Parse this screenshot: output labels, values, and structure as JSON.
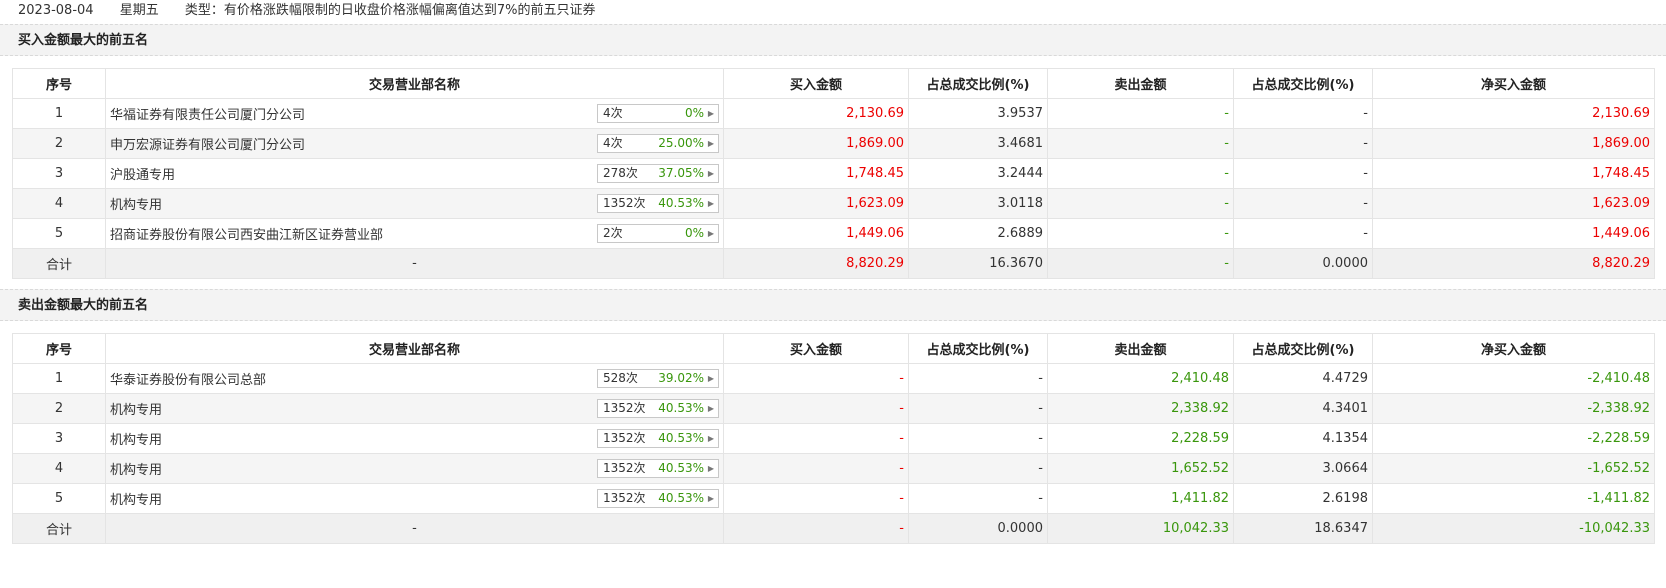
{
  "topline": {
    "date": "2023-08-04",
    "weekday": "星期五",
    "type_text": "类型：有价格涨跌幅限制的日收盘价格涨幅偏离值达到7%的前五只证券"
  },
  "headers": [
    "序号",
    "交易营业部名称",
    "买入金额",
    "占总成交比例(%)",
    "卖出金额",
    "占总成交比例(%)",
    "净买入金额"
  ],
  "buy": {
    "title": "买入金额最大的前五名",
    "rows": [
      {
        "no": "1",
        "name": "华福证券有限责任公司厦门分公司",
        "times": "4次",
        "pct": "0%",
        "buy": "2,130.69",
        "buy_ratio": "3.9537",
        "sell": "-",
        "sell_ratio": "-",
        "net": "2,130.69"
      },
      {
        "no": "2",
        "name": "申万宏源证券有限公司厦门分公司",
        "times": "4次",
        "pct": "25.00%",
        "buy": "1,869.00",
        "buy_ratio": "3.4681",
        "sell": "-",
        "sell_ratio": "-",
        "net": "1,869.00"
      },
      {
        "no": "3",
        "name": "沪股通专用",
        "times": "278次",
        "pct": "37.05%",
        "buy": "1,748.45",
        "buy_ratio": "3.2444",
        "sell": "-",
        "sell_ratio": "-",
        "net": "1,748.45"
      },
      {
        "no": "4",
        "name": "机构专用",
        "times": "1352次",
        "pct": "40.53%",
        "buy": "1,623.09",
        "buy_ratio": "3.0118",
        "sell": "-",
        "sell_ratio": "-",
        "net": "1,623.09"
      },
      {
        "no": "5",
        "name": "招商证券股份有限公司西安曲江新区证券营业部",
        "times": "2次",
        "pct": "0%",
        "buy": "1,449.06",
        "buy_ratio": "2.6889",
        "sell": "-",
        "sell_ratio": "-",
        "net": "1,449.06"
      }
    ],
    "total": {
      "label": "合计",
      "name": "-",
      "buy": "8,820.29",
      "buy_ratio": "16.3670",
      "sell": "-",
      "sell_ratio": "0.0000",
      "net": "8,820.29"
    }
  },
  "sell": {
    "title": "卖出金额最大的前五名",
    "rows": [
      {
        "no": "1",
        "name": "华泰证券股份有限公司总部",
        "times": "528次",
        "pct": "39.02%",
        "buy": "-",
        "buy_ratio": "-",
        "sell": "2,410.48",
        "sell_ratio": "4.4729",
        "net": "-2,410.48"
      },
      {
        "no": "2",
        "name": "机构专用",
        "times": "1352次",
        "pct": "40.53%",
        "buy": "-",
        "buy_ratio": "-",
        "sell": "2,338.92",
        "sell_ratio": "4.3401",
        "net": "-2,338.92"
      },
      {
        "no": "3",
        "name": "机构专用",
        "times": "1352次",
        "pct": "40.53%",
        "buy": "-",
        "buy_ratio": "-",
        "sell": "2,228.59",
        "sell_ratio": "4.1354",
        "net": "-2,228.59"
      },
      {
        "no": "4",
        "name": "机构专用",
        "times": "1352次",
        "pct": "40.53%",
        "buy": "-",
        "buy_ratio": "-",
        "sell": "1,652.52",
        "sell_ratio": "3.0664",
        "net": "-1,652.52"
      },
      {
        "no": "5",
        "name": "机构专用",
        "times": "1352次",
        "pct": "40.53%",
        "buy": "-",
        "buy_ratio": "-",
        "sell": "1,411.82",
        "sell_ratio": "2.6198",
        "net": "-1,411.82"
      }
    ],
    "total": {
      "label": "合计",
      "name": "-",
      "buy": "-",
      "buy_ratio": "0.0000",
      "sell": "10,042.33",
      "sell_ratio": "18.6347",
      "net": "-10,042.33"
    }
  },
  "colors": {
    "up": "#ec0000",
    "down": "#39960c"
  }
}
